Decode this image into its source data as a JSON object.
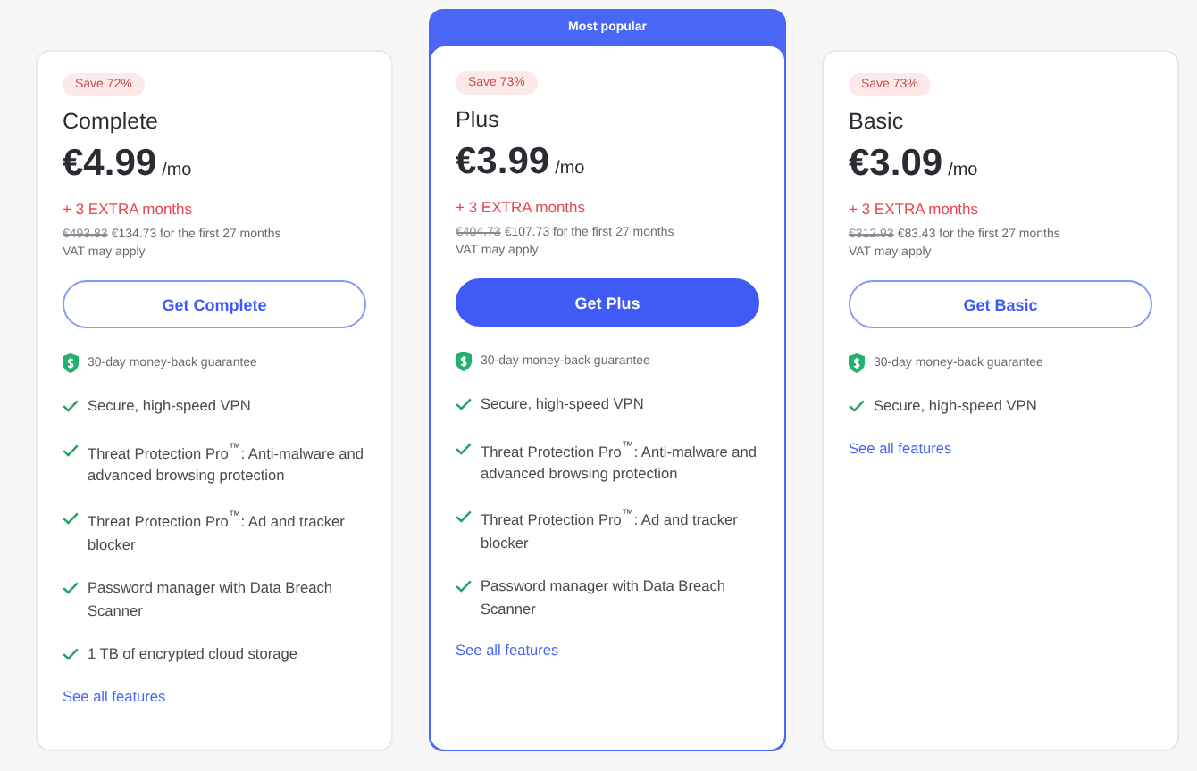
{
  "plans": [
    {
      "name": "Complete",
      "highlight": false,
      "badge": "Save 72%",
      "price": "€4.99",
      "unit": "/mo",
      "extra": "+ 3 EXTRA months",
      "old_price": "€493.83",
      "new_price": "€134.73 for the first 27 months",
      "vat": "VAT may apply",
      "button": "Get Complete",
      "guarantee": "30-day money-back guarantee",
      "features": [
        "Secure, high-speed VPN",
        "Threat Protection Pro$^{™}$: Anti-malware and advanced browsing protection",
        "Threat Protection Pro$^{™}$: Ad and tracker blocker",
        "Password manager with Data Breach Scanner",
        "1 TB of encrypted cloud storage"
      ],
      "link": "See all features"
    },
    {
      "name": "Plus",
      "highlight": true,
      "ribbon": "Most popular",
      "badge": "Save 73%",
      "price": "€3.99",
      "unit": "/mo",
      "extra": "+ 3 EXTRA months",
      "old_price": "€404.73",
      "new_price": "€107.73 for the first 27 months",
      "vat": "VAT may apply",
      "button": "Get Plus",
      "guarantee": "30-day money-back guarantee",
      "features": [
        "Secure, high-speed VPN",
        "Threat Protection Pro$^{™}$: Anti-malware and advanced browsing protection",
        "Threat Protection Pro$^{™}$: Ad and tracker blocker",
        "Password manager with Data Breach Scanner"
      ],
      "link": "See all features"
    },
    {
      "name": "Basic",
      "highlight": false,
      "badge": "Save 73%",
      "price": "€3.09",
      "unit": "/mo",
      "extra": "+ 3 EXTRA months",
      "old_price": "€312.93",
      "new_price": "€83.43 for the first 27 months",
      "vat": "VAT may apply",
      "button": "Get Basic",
      "guarantee": "30-day money-back guarantee",
      "features": [
        "Secure, high-speed VPN"
      ],
      "link": "See all features"
    }
  ]
}
